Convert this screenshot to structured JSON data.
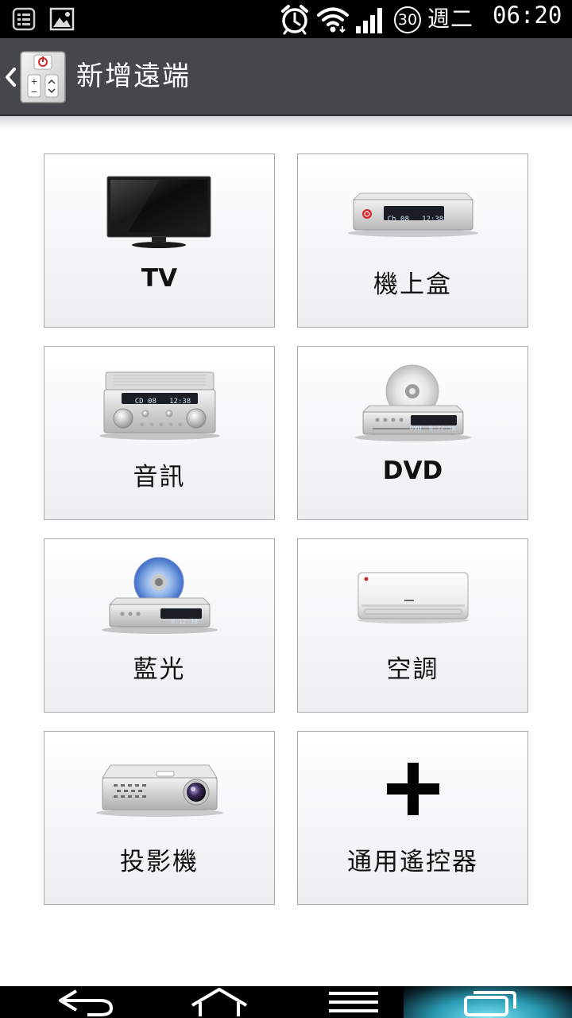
{
  "status_bar": {
    "battery_level": "30",
    "day": "週二",
    "time": "06:20",
    "icons": [
      "notification-icon",
      "gallery-icon",
      "alarm-icon",
      "wifi-icon",
      "signal-icon",
      "battery-icon"
    ]
  },
  "action_bar": {
    "title": "新增遠端",
    "icons": [
      "back-chevron-icon",
      "remote-app-icon"
    ]
  },
  "devices": [
    {
      "label": "TV",
      "icon": "tv-icon"
    },
    {
      "label": "機上盒",
      "icon": "set-top-box-icon",
      "display": "Ch 08   12:38"
    },
    {
      "label": "音訊",
      "icon": "audio-receiver-icon",
      "display": "CD 08   12:38"
    },
    {
      "label": "DVD",
      "icon": "dvd-player-icon",
      "display": "DVD  0:12:38"
    },
    {
      "label": "藍光",
      "icon": "bluray-player-icon",
      "display": "0:12:38"
    },
    {
      "label": "空調",
      "icon": "air-conditioner-icon"
    },
    {
      "label": "投影機",
      "icon": "projector-icon"
    },
    {
      "label": "通用遙控器",
      "icon": "plus-icon"
    }
  ],
  "nav_bar": {
    "icons": [
      "nav-back-icon",
      "nav-home-icon",
      "nav-menu-icon",
      "nav-recent-apps-icon"
    ]
  },
  "colors": {
    "status_bar": "#000000",
    "action_bar": "#44474c",
    "tile_border": "#a8a8aa",
    "recent_glow": "#7de6f7",
    "power_red": "#d8262c"
  }
}
